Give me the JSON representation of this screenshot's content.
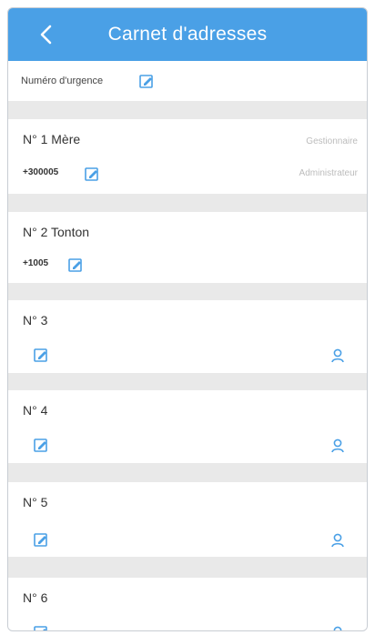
{
  "header": {
    "title": "Carnet d'adresses"
  },
  "emergency": {
    "label": "Numéro d'urgence"
  },
  "contacts": [
    {
      "name": "N° 1 Mère",
      "phone": "+300005",
      "role": "Administrateur",
      "sub_role": "Gestionnaire"
    },
    {
      "name": "N° 2 Tonton",
      "phone": "+1005"
    },
    {
      "name": "N° 3"
    },
    {
      "name": "N° 4"
    },
    {
      "name": "N° 5"
    },
    {
      "name": "N° 6"
    }
  ],
  "colors": {
    "accent": "#4aa0e6",
    "separator": "#e9e9e9",
    "icon": "#4aa0e6"
  }
}
